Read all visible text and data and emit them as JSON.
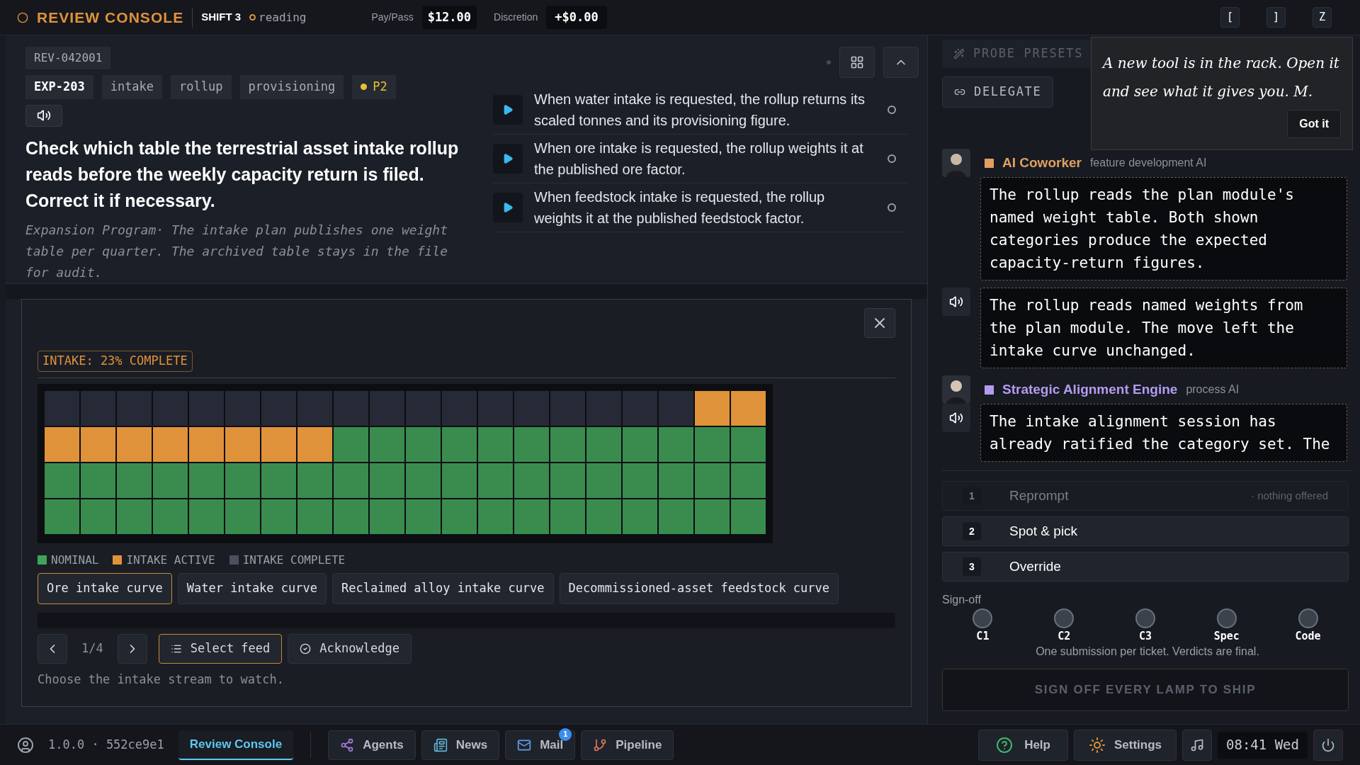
{
  "top_bar": {
    "title": "REVIEW CONSOLE",
    "shift": "SHIFT 3",
    "status": "reading",
    "pay_label": "Pay/Pass",
    "pay_value": "$12.00",
    "discretion_label": "Discretion",
    "discretion_value": "+$0.00",
    "keys": [
      "[",
      "]",
      "Z"
    ]
  },
  "ticket": {
    "id": "REV-042001",
    "tags": [
      {
        "label": "EXP-203",
        "kind": "code"
      },
      {
        "label": "intake",
        "kind": "tag"
      },
      {
        "label": "rollup",
        "kind": "tag"
      },
      {
        "label": "provisioning",
        "kind": "tag"
      },
      {
        "label": "P2",
        "kind": "priority"
      }
    ],
    "question": "Check which table the terrestrial asset intake rollup reads before the weekly capacity return is filed. Correct it if necessary.",
    "context": "Expansion Program· The intake plan publishes one weight table per quarter. The archived table stays in the file for audit."
  },
  "claims": [
    {
      "text": "When water intake is requested, the rollup returns its scaled tonnes and its provisioning figure.",
      "checked": false
    },
    {
      "text": "When ore intake is requested, the rollup weights it at the published ore factor.",
      "checked": false
    },
    {
      "text": "When feedstock intake is requested, the rollup weights it at the published feedstock factor.",
      "checked": false
    }
  ],
  "modal": {
    "badge": "INTAKE: 23% COMPLETE",
    "grid": [
      {
        "cells": [
          {
            "kind": "complete"
          },
          {
            "kind": "complete"
          },
          {
            "kind": "complete"
          },
          {
            "kind": "complete"
          },
          {
            "kind": "complete"
          },
          {
            "kind": "complete"
          },
          {
            "kind": "complete"
          },
          {
            "kind": "complete"
          },
          {
            "kind": "complete"
          },
          {
            "kind": "complete"
          },
          {
            "kind": "complete"
          },
          {
            "kind": "complete"
          },
          {
            "kind": "complete"
          },
          {
            "kind": "complete"
          },
          {
            "kind": "complete"
          },
          {
            "kind": "complete"
          },
          {
            "kind": "complete"
          },
          {
            "kind": "complete"
          },
          {
            "kind": "active"
          },
          {
            "kind": "active"
          }
        ]
      },
      {
        "cells": [
          {
            "kind": "active"
          },
          {
            "kind": "active"
          },
          {
            "kind": "active"
          },
          {
            "kind": "active"
          },
          {
            "kind": "active"
          },
          {
            "kind": "active"
          },
          {
            "kind": "active"
          },
          {
            "kind": "active"
          },
          {
            "kind": "nominal"
          },
          {
            "kind": "nominal"
          },
          {
            "kind": "nominal"
          },
          {
            "kind": "nominal"
          },
          {
            "kind": "nominal"
          },
          {
            "kind": "nominal"
          },
          {
            "kind": "nominal"
          },
          {
            "kind": "nominal"
          },
          {
            "kind": "nominal"
          },
          {
            "kind": "nominal"
          },
          {
            "kind": "nominal"
          },
          {
            "kind": "nominal"
          }
        ]
      },
      {
        "cells": [
          {
            "kind": "nominal"
          },
          {
            "kind": "nominal"
          },
          {
            "kind": "nominal"
          },
          {
            "kind": "nominal"
          },
          {
            "kind": "nominal"
          },
          {
            "kind": "nominal"
          },
          {
            "kind": "nominal"
          },
          {
            "kind": "nominal"
          },
          {
            "kind": "nominal"
          },
          {
            "kind": "nominal"
          },
          {
            "kind": "nominal"
          },
          {
            "kind": "nominal"
          },
          {
            "kind": "nominal"
          },
          {
            "kind": "nominal"
          },
          {
            "kind": "nominal"
          },
          {
            "kind": "nominal"
          },
          {
            "kind": "nominal"
          },
          {
            "kind": "nominal"
          },
          {
            "kind": "nominal"
          },
          {
            "kind": "nominal"
          }
        ]
      },
      {
        "cells": [
          {
            "kind": "nominal"
          },
          {
            "kind": "nominal"
          },
          {
            "kind": "nominal"
          },
          {
            "kind": "nominal"
          },
          {
            "kind": "nominal"
          },
          {
            "kind": "nominal"
          },
          {
            "kind": "nominal"
          },
          {
            "kind": "nominal"
          },
          {
            "kind": "nominal"
          },
          {
            "kind": "nominal"
          },
          {
            "kind": "nominal"
          },
          {
            "kind": "nominal"
          },
          {
            "kind": "nominal"
          },
          {
            "kind": "nominal"
          },
          {
            "kind": "nominal"
          },
          {
            "kind": "nominal"
          },
          {
            "kind": "nominal"
          },
          {
            "kind": "nominal"
          },
          {
            "kind": "nominal"
          },
          {
            "kind": "nominal"
          }
        ]
      }
    ],
    "legend": [
      {
        "label": "NOMINAL",
        "color": "#3fa35a"
      },
      {
        "label": "INTAKE ACTIVE",
        "color": "#e0923a"
      },
      {
        "label": "INTAKE COMPLETE",
        "color": "#4a5060"
      }
    ],
    "curves": [
      {
        "label": "Ore intake curve",
        "selected": true
      },
      {
        "label": "Water intake curve",
        "selected": false
      },
      {
        "label": "Reclaimed alloy intake curve",
        "selected": false
      },
      {
        "label": "Decommissioned-asset feedstock curve",
        "selected": false
      }
    ],
    "page": "1/4",
    "select_button": "Select feed",
    "ack_button": "Acknowledge",
    "hint": "Choose the intake stream to watch."
  },
  "side": {
    "probe": "PROBE PRESETS",
    "delegate": "DELEGATE",
    "note": {
      "text": "A new tool is in the rack. Open it and see what it gives you. M.",
      "button": "Got it"
    },
    "messages": [
      {
        "kind": "header",
        "name": "AI Coworker",
        "role": "feature development AI",
        "color": "#e0a060"
      },
      {
        "kind": "bubble",
        "text": "The rollup reads the plan module's named weight table. Both shown categories produce the expected capacity-return figures.",
        "speaker": false
      },
      {
        "kind": "bubble",
        "text": "The rollup reads named weights from the plan module. The move left the intake curve unchanged.",
        "speaker": true
      },
      {
        "kind": "header",
        "name": "Strategic Alignment Engine",
        "role": "process AI",
        "color": "#b39cf0"
      },
      {
        "kind": "bubble",
        "text": "The intake alignment session has already ratified the category set. The",
        "speaker": true
      }
    ],
    "options": [
      {
        "key": "1",
        "label": "Reprompt",
        "note": "· nothing offered",
        "disabled": true
      },
      {
        "key": "2",
        "label": "Spot & pick",
        "disabled": false
      },
      {
        "key": "3",
        "label": "Override",
        "disabled": false
      }
    ],
    "signoff_label": "Sign-off",
    "lamps": [
      {
        "label": "C1",
        "on": false
      },
      {
        "label": "C2",
        "on": false
      },
      {
        "label": "C3",
        "on": false
      },
      {
        "label": "Spec",
        "on": false
      },
      {
        "label": "Code",
        "on": false
      }
    ],
    "signoff_note": "One submission per ticket. Verdicts are final.",
    "ship": "SIGN OFF EVERY LAMP TO SHIP"
  },
  "taskbar": {
    "version": "1.0.0 · 552ce9e1",
    "apps": [
      {
        "label": "Review Console",
        "kind": "plain",
        "selected": true
      },
      {
        "label": "Agents",
        "kind": "agents",
        "selected": false
      },
      {
        "label": "News",
        "kind": "news",
        "selected": false
      },
      {
        "label": "Mail",
        "kind": "mail",
        "selected": false,
        "badge": "1"
      },
      {
        "label": "Pipeline",
        "kind": "pipeline",
        "selected": false
      }
    ],
    "help": "Help",
    "settings": "Settings",
    "clock": "08:41 Wed"
  }
}
